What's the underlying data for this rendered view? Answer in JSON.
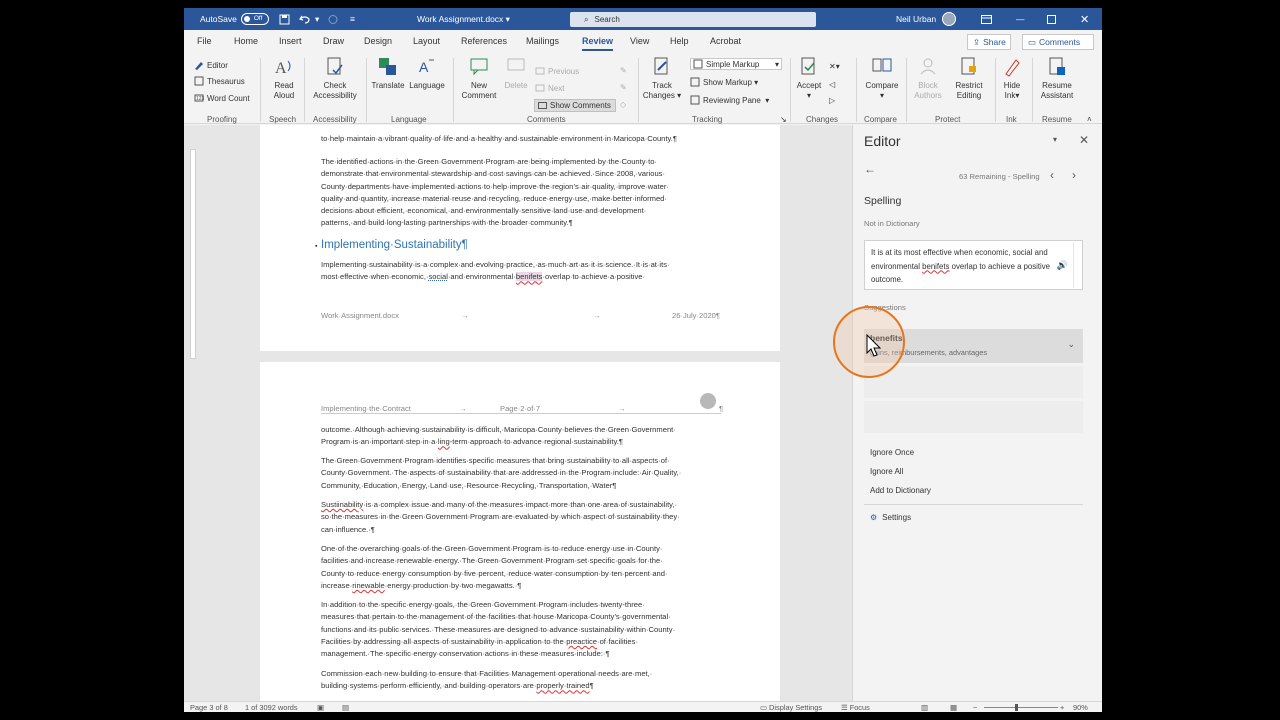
{
  "titlebar": {
    "autosave_label": "AutoSave",
    "autosave_state": "Off",
    "doc_title": "Work Assignment.docx",
    "search_placeholder": "Search",
    "user_name": "Neil Urban"
  },
  "ribbon_tabs": [
    "File",
    "Home",
    "Insert",
    "Draw",
    "Design",
    "Layout",
    "References",
    "Mailings",
    "Review",
    "View",
    "Help",
    "Acrobat"
  ],
  "active_tab": "Review",
  "share_label": "Share",
  "comments_label": "Comments",
  "ribbon": {
    "proofing": {
      "editor": "Editor",
      "thesaurus": "Thesaurus",
      "word_count": "Word Count",
      "group": "Proofing"
    },
    "speech": {
      "read_aloud_1": "Read",
      "read_aloud_2": "Aloud",
      "group": "Speech"
    },
    "accessibility": {
      "check_1": "Check",
      "check_2": "Accessibility",
      "group": "Accessibility"
    },
    "language": {
      "translate": "Translate",
      "language": "Language",
      "group": "Language"
    },
    "comments": {
      "new_1": "New",
      "new_2": "Comment",
      "delete": "Delete",
      "previous": "Previous",
      "next": "Next",
      "show_comments": "Show Comments",
      "group": "Comments"
    },
    "tracking": {
      "track_1": "Track",
      "track_2": "Changes",
      "markup": "Simple Markup",
      "show_markup": "Show Markup",
      "reviewing_pane": "Reviewing Pane",
      "group": "Tracking"
    },
    "changes": {
      "accept": "Accept",
      "group": "Changes"
    },
    "compare": {
      "compare": "Compare",
      "group": "Compare"
    },
    "protect": {
      "block_1": "Block",
      "block_2": "Authors",
      "restrict_1": "Restrict",
      "restrict_2": "Editing",
      "group": "Protect"
    },
    "ink": {
      "hide_1": "Hide",
      "hide_2": "Ink",
      "group": "Ink"
    },
    "resume": {
      "resume_1": "Resume",
      "resume_2": "Assistant",
      "group": "Resume"
    }
  },
  "document": {
    "page1": {
      "top_line": "to·help·maintain·a·vibrant·quality·of·life·and·a·healthy·and·sustainable·environment·in·Maricopa·County.¶",
      "para1": [
        "The·identified·actions·in·the·Green·Government·Program·are·being·implemented·by·the·County·to·",
        "demonstrate·that·environmental·stewardship·and·cost·savings·can·be·achieved.·Since·2008,·various·",
        "County·departments·have·implemented·actions·to·help·improve·the·region’s·air·quality,·improve·water·",
        "quality·and·quantity,·increase·material·reuse·and·recycling,·reduce·energy·use,·make·better·informed·",
        "decisions·about·efficient,·economical,·and·environmentally·sensitive·land·use·and·development·",
        "patterns,·and·build·long-lasting·partnerships·with·the·broader·community.¶"
      ],
      "heading": "Implementing·Sustainability¶",
      "para2_line1": "Implementing·sustainability·is·a·complex·and·evolving·practice,·as·much·art·as·it·is·science.·It·is·at·its·",
      "para2_line2_a": "most·effective·when·economic,·",
      "para2_line2_social": "social",
      "para2_line2_b": "·and·environmental·",
      "para2_line2_err": "benifets",
      "para2_line2_c": "·overlap·to·achieve·a·positive·",
      "footer_left": "Work·Assignment.docx",
      "footer_arrow1": "→",
      "footer_arrow2": "→",
      "footer_right": "26·July·2020¶"
    },
    "page2": {
      "header_left": "Implementing·the·Contract",
      "header_arrow1": "→",
      "header_mid": "Page·2·of·7",
      "header_arrow2": "→",
      "header_end": "¶",
      "p1_l1": "outcome.·Although·achieving·sustainability·is·difficult,·Maricopa·County·believes·the·Green·Government·",
      "p1_l2a": "Program·is·an·important·step·in·a·",
      "p1_l2err": "ling",
      "p1_l2b": "-term·approach·to·advance·regional·sustainability.¶",
      "p2": [
        "The·Green·Government·Program·identifies·specific·measures·that·bring·sustainability·to·all·aspects·of·",
        "County·Government.·The·aspects·of·sustainability·that·are·addressed·in·the·Program·include:·Air·Quality,·",
        "Community,·Education,·Energy,·Land·use,·Resource·Recycling,·Transportation,·Water¶"
      ],
      "p3_err": "Sustiinability",
      "p3_l1": "·is·a·complex·issue·and·many·of·the·measures·impact·more·than·one·area·of·sustainability,·",
      "p3_l2": "so·the·measures·in·the·Green·Government·Program·are·evaluated·by·which·aspect·of·sustainability·they·",
      "p3_l3": "can·influence.·¶",
      "p4_l1": "One·of·the·overarching·goals·of·the·Green·Government·Program·is·to·reduce·energy·use·in·County·",
      "p4_l2": "facilities·and·increase·renewable·energy.·The·Green·Government·Program·set·specific·goals·for·the·",
      "p4_l3": "County·to·reduce·energy·consumption·by·five·percent,·reduce·water·consumption·by·ten·percent·and·",
      "p4_l4a": "increase·",
      "p4_l4err": "rinewable",
      "p4_l4b": "·energy·production·by·two·megawatts.·¶",
      "p5_l1": "In·addition·to·the·specific·energy·goals,·the·Green·Government·Program·includes·twenty-three·",
      "p5_l2": "measures·that·pertain·to·the·management·of·the·facilities·that·house·Maricopa·County’s·governmental·",
      "p5_l3": "functions·and·its·public·services.·These·measures·are·designed·to·advance·sustainability·within·County·",
      "p5_l4a": "Facilities·by·addressing·all·aspects·of·sustainability·in·application·to·the·",
      "p5_l4err": "preactice",
      "p5_l4b": "·of·facilities·",
      "p5_l5": "management.·The·specific·energy·conservation·actions·in·these·measures·include:·¶",
      "p6_l1": "Commission·each·new·building·to·ensure·that·Facilities·Management·operational·needs·are·met,·",
      "p6_l2a": "building·systems·perform·efficiently,·and·building·operators·are·",
      "p6_l2err": "properly·trained",
      "p6_l2b": "¶"
    }
  },
  "editor_pane": {
    "title": "Editor",
    "remaining": "63 Remaining - Spelling",
    "heading": "Spelling",
    "subheading": "Not in Dictionary",
    "context_a": "It is at its most effective when economic, social and environmental ",
    "context_err": "benifets",
    "context_b": " overlap to achieve a positive outcome.",
    "suggestions_label": "Suggestions",
    "suggestion_word": "benefits",
    "suggestion_synonyms": "gains, reimbursements, advantages",
    "ignore_once": "Ignore Once",
    "ignore_all": "Ignore All",
    "add_to_dictionary": "Add to Dictionary",
    "settings": "Settings"
  },
  "statusbar": {
    "page": "Page 3 of 8",
    "words": "1 of 3092 words",
    "display_settings": "Display Settings",
    "focus": "Focus",
    "zoom": "90%"
  }
}
